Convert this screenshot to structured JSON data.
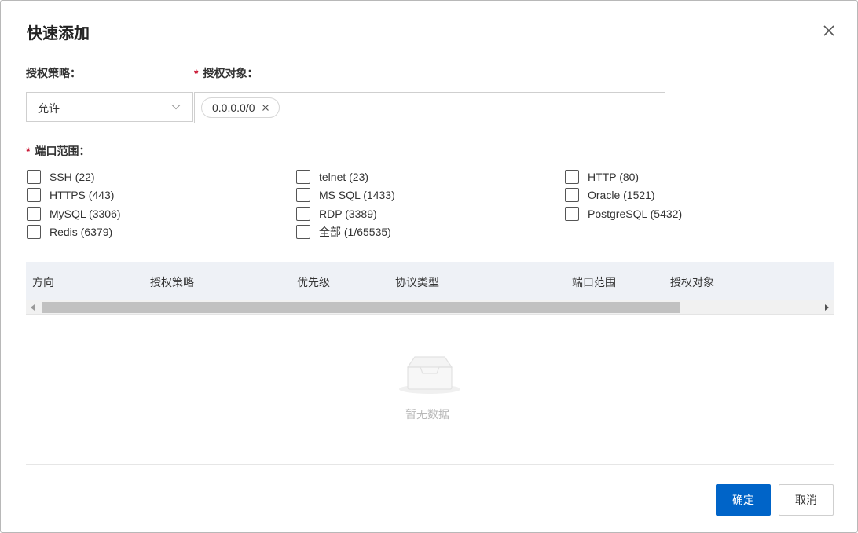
{
  "dialog": {
    "title": "快速添加",
    "close_icon": "close-icon"
  },
  "form": {
    "policy_label": "授权策略：",
    "policy_value": "允许",
    "target_label": "授权对象：",
    "target_tags": [
      "0.0.0.0/0"
    ],
    "port_label": "端口范围："
  },
  "ports": [
    {
      "label": "SSH (22)",
      "checked": false
    },
    {
      "label": "HTTPS (443)",
      "checked": false
    },
    {
      "label": "MySQL (3306)",
      "checked": false
    },
    {
      "label": "Redis (6379)",
      "checked": false
    },
    {
      "label": "telnet (23)",
      "checked": false
    },
    {
      "label": "MS SQL (1433)",
      "checked": false
    },
    {
      "label": "RDP (3389)",
      "checked": false
    },
    {
      "label": "全部 (1/65535)",
      "checked": false
    },
    {
      "label": "HTTP (80)",
      "checked": false
    },
    {
      "label": "Oracle (1521)",
      "checked": false
    },
    {
      "label": "PostgreSQL (5432)",
      "checked": false
    }
  ],
  "table": {
    "columns": [
      "方向",
      "授权策略",
      "优先级",
      "协议类型",
      "端口范围",
      "授权对象"
    ],
    "empty_text": "暂无数据"
  },
  "footer": {
    "ok_label": "确定",
    "cancel_label": "取消"
  },
  "colors": {
    "primary": "#0064c8",
    "required": "#c8102e",
    "header_bg": "#eef1f6"
  }
}
